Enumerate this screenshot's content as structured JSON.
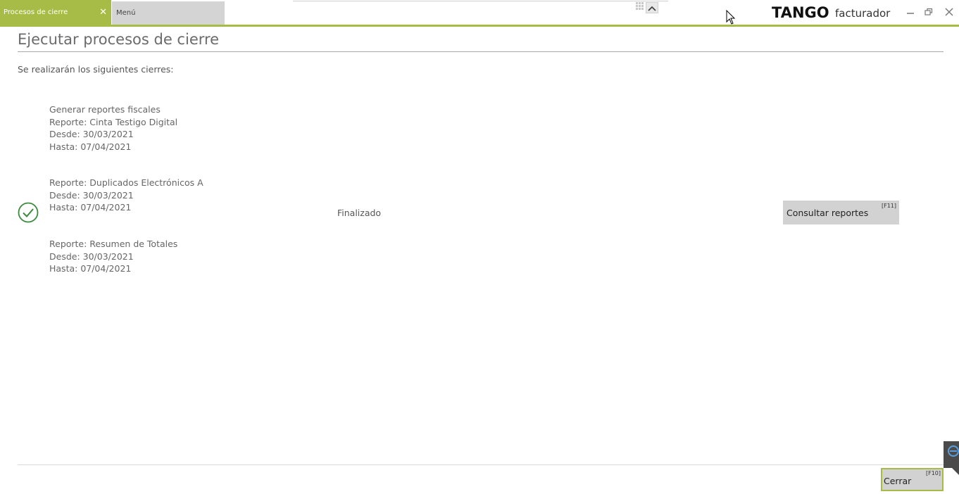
{
  "tabs": {
    "active_label": "Procesos de cierre",
    "active_close": "✕",
    "menu_label": "Menú"
  },
  "brand": {
    "logo_text": "TANGO",
    "product_name": "facturador",
    "accent_color": "#a7bc46"
  },
  "icons": {
    "grid": "grid-icon",
    "chevron": "chevron-up-icon",
    "minimize": "minimize-icon",
    "restore": "restore-icon",
    "close": "close-icon",
    "check": "check-circle-icon",
    "cursor": "mouse-cursor-icon",
    "side": "side-panel-icon"
  },
  "page": {
    "title": "Ejecutar procesos de cierre",
    "intro": "Se realizarán los siguientes cierres:"
  },
  "process": {
    "heading": "Generar reportes fiscales",
    "status": "Finalizado",
    "reports": [
      {
        "name": "Reporte: Cinta Testigo Digital",
        "from": "Desde: 30/03/2021",
        "to": "Hasta: 07/04/2021"
      },
      {
        "name": "Reporte: Duplicados Electrónicos A",
        "from": "Desde: 30/03/2021",
        "to": "Hasta: 07/04/2021"
      },
      {
        "name": "Reporte: Resumen de Totales",
        "from": "Desde: 30/03/2021",
        "to": "Hasta: 07/04/2021"
      }
    ]
  },
  "buttons": {
    "consult_label": "Consultar reportes",
    "consult_key": "[F11]",
    "close_label": "Cerrar",
    "close_key": "[F10]"
  }
}
